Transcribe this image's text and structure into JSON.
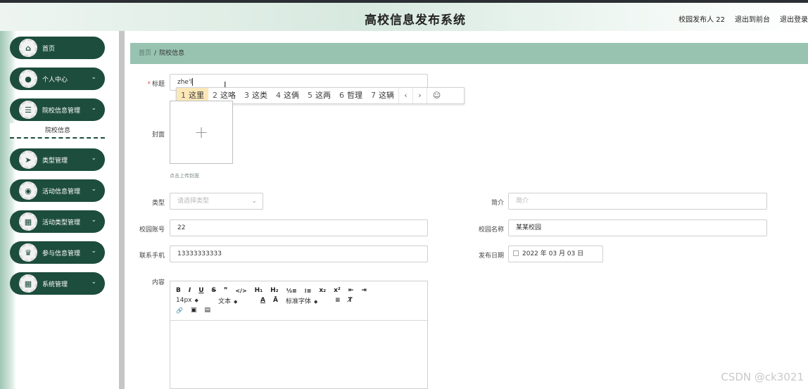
{
  "header": {
    "title": "高校信息发布系统",
    "user": "校园发布人 22",
    "back_to_front": "退出到前台",
    "logout": "退出登录"
  },
  "sidebar": {
    "items": [
      {
        "label": "首页",
        "icon": "home-icon",
        "glyph": "⌂",
        "has_children": false
      },
      {
        "label": "个人中心",
        "icon": "user-icon",
        "glyph": "●",
        "has_children": true
      },
      {
        "label": "院校信息管理",
        "icon": "sliders-icon",
        "glyph": "☰",
        "has_children": true
      },
      {
        "label": "类型管理",
        "icon": "send-icon",
        "glyph": "➤",
        "has_children": true
      },
      {
        "label": "活动信息管理",
        "icon": "location-icon",
        "glyph": "◉",
        "has_children": true
      },
      {
        "label": "活动类型管理",
        "icon": "grid-icon",
        "glyph": "▦",
        "has_children": true
      },
      {
        "label": "参与信息管理",
        "icon": "trophy-icon",
        "glyph": "♛",
        "has_children": true
      },
      {
        "label": "系统管理",
        "icon": "grid-icon",
        "glyph": "▦",
        "has_children": true
      }
    ],
    "chevron": "⌄",
    "submenu_item": "院校信息"
  },
  "breadcrumb": {
    "home": "首页",
    "separator": "/",
    "current": "院校信息"
  },
  "form": {
    "title_label": "标题",
    "title_required_mark": "*",
    "title_value": "zhe'l",
    "cover_label": "封面",
    "upload_plus": "+",
    "upload_tip": "点击上传封面",
    "type_label": "类型",
    "type_placeholder": "请选择类型",
    "select_arrow": "⌄",
    "intro_label": "简介",
    "intro_placeholder": "简介",
    "campus_account_label": "校园账号",
    "campus_account_value": "22",
    "campus_name_label": "校园名称",
    "campus_name_value": "某某校园",
    "phone_label": "联系手机",
    "phone_value": "13333333333",
    "date_label": "发布日期",
    "date_value": "2022 年 03 月 03 日",
    "content_label": "内容"
  },
  "ime": {
    "candidates": [
      {
        "num": "1",
        "text": "这里"
      },
      {
        "num": "2",
        "text": "这咯"
      },
      {
        "num": "3",
        "text": "这类"
      },
      {
        "num": "4",
        "text": "这俩"
      },
      {
        "num": "5",
        "text": "这两"
      },
      {
        "num": "6",
        "text": "哲理"
      },
      {
        "num": "7",
        "text": "这辆"
      }
    ],
    "prev": "‹",
    "next": "›",
    "emoji": "☺"
  },
  "editor_toolbar": {
    "bold": "B",
    "italic": "I",
    "underline": "U",
    "strike": "S",
    "quote": "❞",
    "code": "</>",
    "h1": "H₁",
    "h2": "H₂",
    "ordered_list": "⅓≡",
    "bullet_list": "⁝≡",
    "subscript": "x₂",
    "superscript": "x²",
    "outdent": "⇤",
    "indent": "⇥",
    "font_size": "14px",
    "block_type": "文本",
    "font_color": "A",
    "bg_color": "Ā",
    "font_family": "标准字体",
    "align": "≡",
    "clean": "T̸",
    "link": "🔗",
    "image": "▣",
    "video": "▤"
  },
  "watermark": "CSDN @ck3021",
  "colors": {
    "nav_bg": "#1d4d3c",
    "breadcrumb_bg": "#98c3b0",
    "ime_active": "#fbe7b8"
  }
}
